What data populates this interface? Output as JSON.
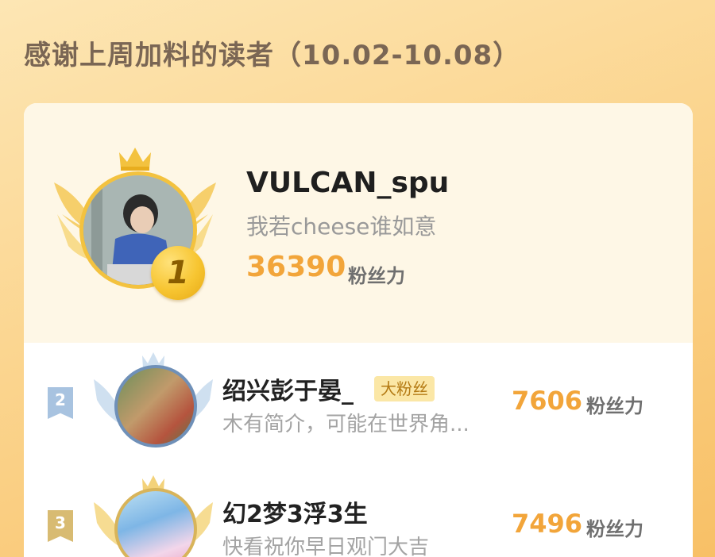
{
  "header": {
    "title": "感谢上周加料的读者（10.02-10.08）"
  },
  "colors": {
    "accent_orange": "#f2a53a",
    "gold": "#f3c23f",
    "silver_blue": "#6f90b8",
    "bronze": "#d8b45a"
  },
  "champion": {
    "rank": "1",
    "name": "VULCAN_spu",
    "bio": "我若cheese谁如意",
    "score": "36390",
    "unit": "粉丝力"
  },
  "ranking": [
    {
      "rank": "2",
      "name": "绍兴彭于晏_",
      "tag": "大粉丝",
      "bio": "木有简介，可能在世界角...",
      "score": "7606",
      "unit": "粉丝力"
    },
    {
      "rank": "3",
      "name": "幻2梦3浮3生",
      "tag": "",
      "bio": "快看祝你早日观门大吉",
      "score": "7496",
      "unit": "粉丝力"
    }
  ]
}
